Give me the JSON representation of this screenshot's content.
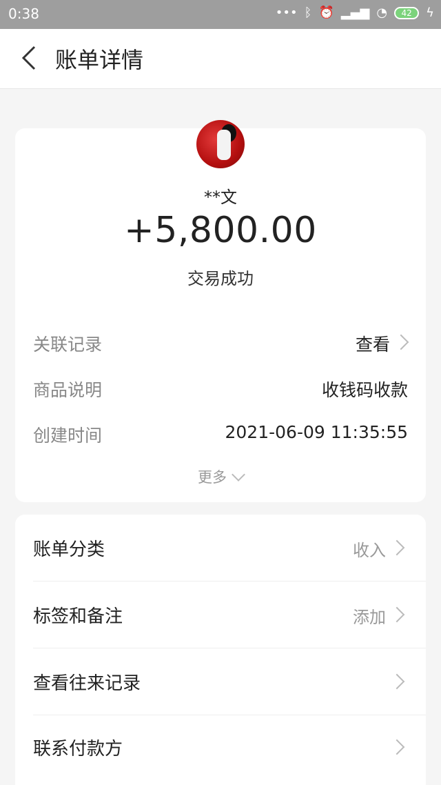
{
  "status_bar": {
    "time": "0:38",
    "battery": "42"
  },
  "nav": {
    "title": "账单详情"
  },
  "summary": {
    "name": "**文",
    "amount": "+5,800.00",
    "status": "交易成功"
  },
  "details": {
    "rows": [
      {
        "label": "关联记录",
        "value": "查看"
      },
      {
        "label": "商品说明",
        "value": "收钱码收款"
      },
      {
        "label": "创建时间",
        "value": "2021-06-09 11:35:55"
      }
    ],
    "more": "更多"
  },
  "actions": {
    "items": [
      {
        "label": "账单分类",
        "value": "收入"
      },
      {
        "label": "标签和备注",
        "value": "添加"
      },
      {
        "label": "查看往来记录",
        "value": ""
      },
      {
        "label": "联系付款方",
        "value": ""
      }
    ]
  }
}
